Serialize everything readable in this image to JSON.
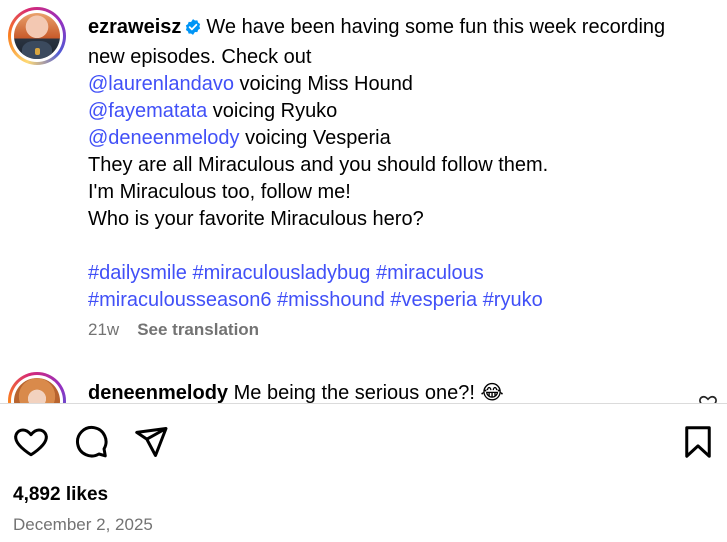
{
  "post": {
    "username": "ezraweisz",
    "verified": true,
    "lines": {
      "l1": "We have been having some fun this week recording",
      "l2": "new episodes. Check out",
      "m1": "@laurenlandavo",
      "m1_text": " voicing Miss Hound",
      "m2": "@fayematata",
      "m2_text": " voicing Ryuko",
      "m3": "@deneenmelody",
      "m3_text": " voicing Vesperia",
      "l6": "They are all Miraculous and you should follow them.",
      "l7": "I'm Miraculous too, follow me!",
      "l8": "Who is your favorite Miraculous hero?"
    },
    "hashtags_line1": [
      "#dailysmile",
      "#miraculousladybug",
      "#miraculous"
    ],
    "hashtags_line2": [
      "#miraculousseason6",
      "#misshound",
      "#vesperia",
      "#ryuko"
    ],
    "age": "21w",
    "see_translation": "See translation"
  },
  "comment": {
    "username": "deneenmelody",
    "text": "Me being the serious one?! 😂"
  },
  "actions": {
    "like_icon": "heart-icon",
    "comment_icon": "comment-icon",
    "share_icon": "share-icon",
    "save_icon": "bookmark-icon"
  },
  "stats": {
    "likes": "4,892 likes",
    "date": "December 2, 2025"
  },
  "colors": {
    "link": "#4150f7",
    "muted": "#737373",
    "verified": "#0095f6"
  }
}
